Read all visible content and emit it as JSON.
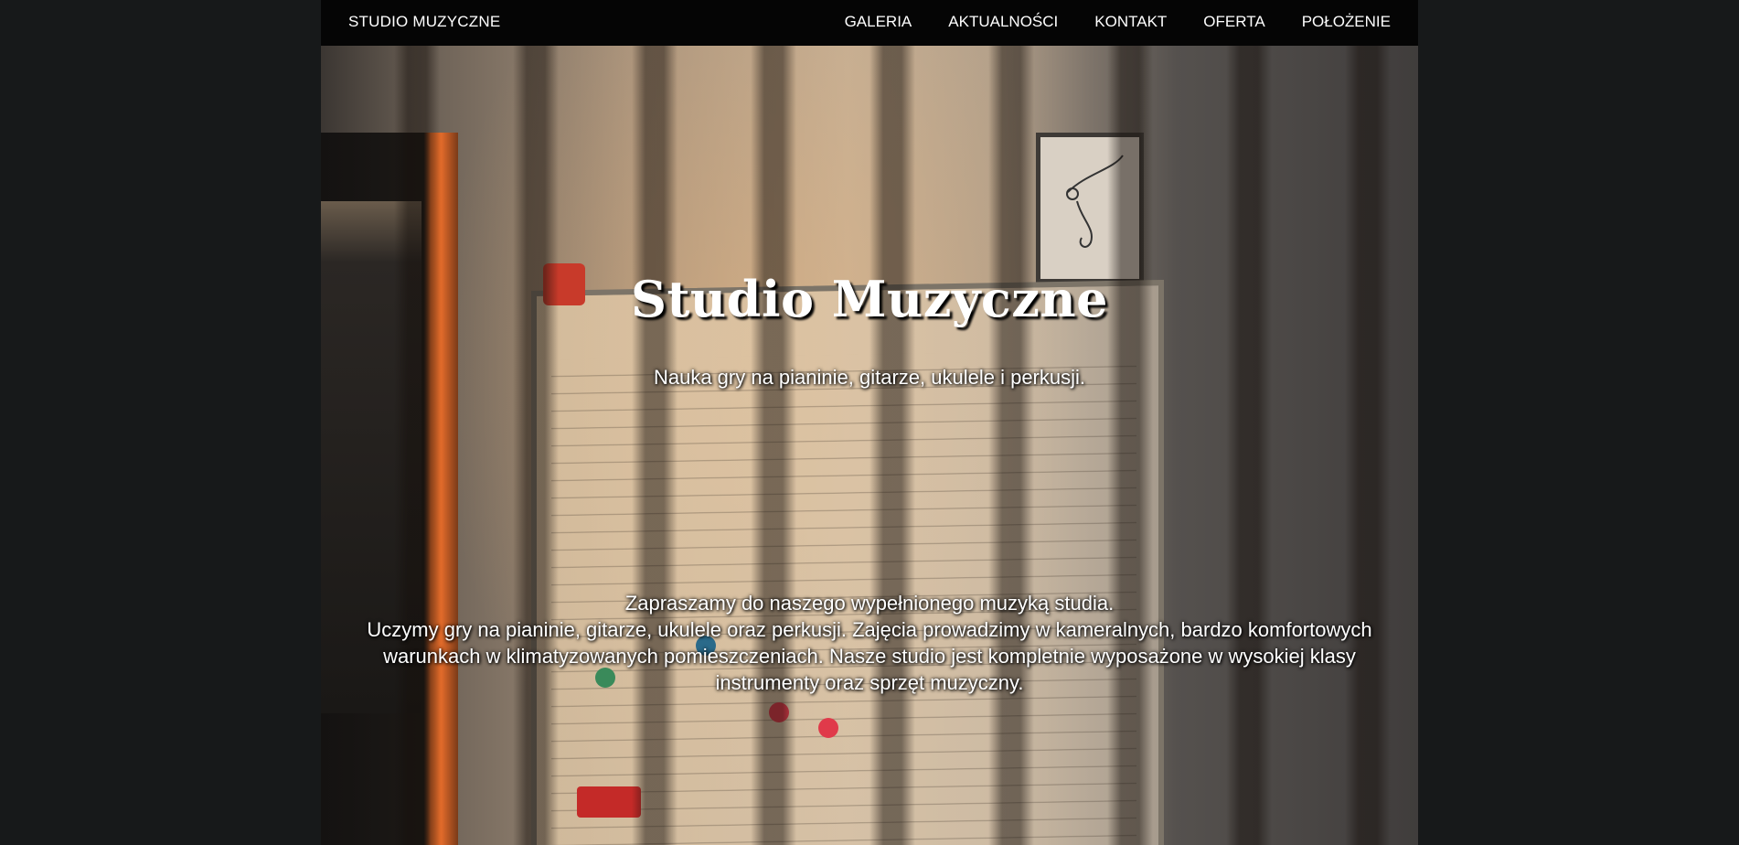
{
  "navbar": {
    "brand": "STUDIO MUZYCZNE",
    "links": [
      {
        "label": "GALERIA"
      },
      {
        "label": "AKTUALNOŚCI"
      },
      {
        "label": "KONTAKT"
      },
      {
        "label": "OFERTA"
      },
      {
        "label": "POŁOŻENIE"
      }
    ]
  },
  "hero": {
    "title": "Studio Muzyczne",
    "subtitle": "Nauka gry na pianinie, gitarze, ukulele i perkusji.",
    "body_line1": "Zapraszamy do naszego wypełnionego muzyką studia.",
    "body_rest": "Uczymy gry na pianinie, gitarze, ukulele oraz perkusji. Zajęcia prowadzimy w kameralnych, bardzo komfortowych warunkach w klimatyzowanych pomieszczeniach. Nasze studio jest kompletnie wyposażone w wysokiej klasy instrumenty oraz sprzęt muzyczny."
  },
  "colors": {
    "page_background": "#17191a",
    "navbar_background": "#050505",
    "text": "#ffffff"
  }
}
